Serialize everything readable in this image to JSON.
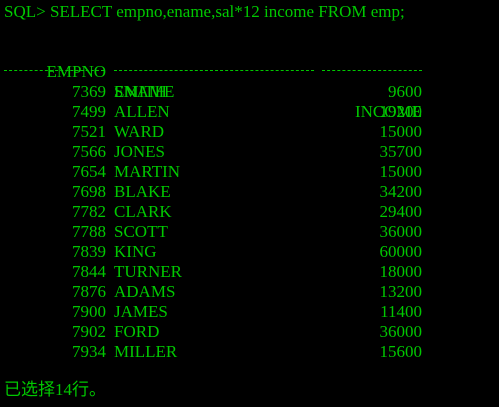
{
  "console": {
    "prompt": "SQL> SELECT empno,ename,sal*12 income FROM emp;",
    "headers": {
      "empno": "EMPNO",
      "ename": "ENAME",
      "income": "INCOME"
    },
    "rows": [
      {
        "empno": "7369",
        "ename": "SMITH",
        "income": "9600"
      },
      {
        "empno": "7499",
        "ename": "ALLEN",
        "income": "19200"
      },
      {
        "empno": "7521",
        "ename": "WARD",
        "income": "15000"
      },
      {
        "empno": "7566",
        "ename": "JONES",
        "income": "35700"
      },
      {
        "empno": "7654",
        "ename": "MARTIN",
        "income": "15000"
      },
      {
        "empno": "7698",
        "ename": "BLAKE",
        "income": "34200"
      },
      {
        "empno": "7782",
        "ename": "CLARK",
        "income": "29400"
      },
      {
        "empno": "7788",
        "ename": "SCOTT",
        "income": "36000"
      },
      {
        "empno": "7839",
        "ename": "KING",
        "income": "60000"
      },
      {
        "empno": "7844",
        "ename": "TURNER",
        "income": "18000"
      },
      {
        "empno": "7876",
        "ename": "ADAMS",
        "income": "13200"
      },
      {
        "empno": "7900",
        "ename": "JAMES",
        "income": "11400"
      },
      {
        "empno": "7902",
        "ename": "FORD",
        "income": "36000"
      },
      {
        "empno": "7934",
        "ename": "MILLER",
        "income": "15600"
      }
    ],
    "footer": "已选择14行。",
    "colors": {
      "background": "#000000",
      "text": "#00c800"
    }
  }
}
